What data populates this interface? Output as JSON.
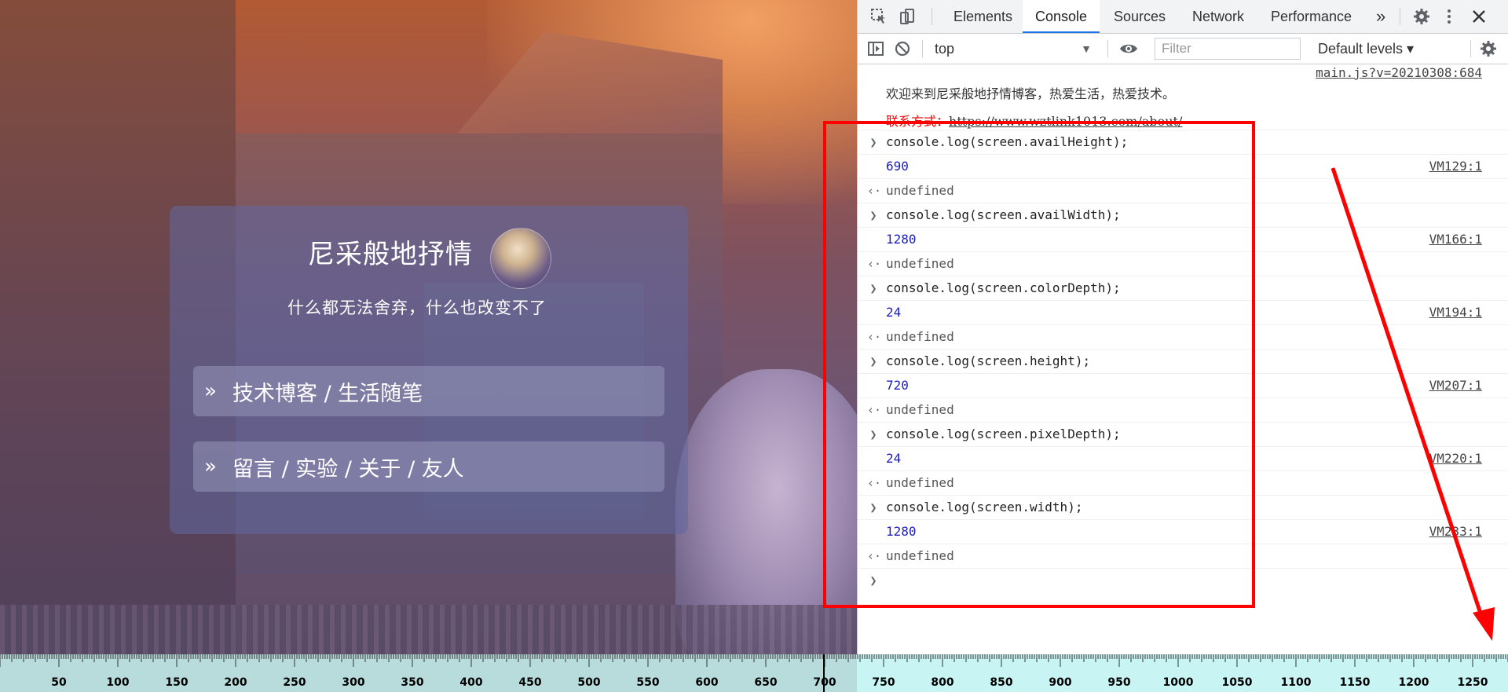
{
  "page": {
    "card": {
      "title": "尼采般地抒情",
      "subtitle": "什么都无法舍弃，什么也改变不了",
      "links": [
        {
          "chevron": "»",
          "label": "技术博客 / 生活随笔"
        },
        {
          "chevron": "»",
          "label": "留言 / 实验 / 关于 / 友人"
        }
      ]
    }
  },
  "devtools": {
    "tabs": [
      "Elements",
      "Console",
      "Sources",
      "Network",
      "Performance"
    ],
    "active_tab": "Console",
    "more_tabs": "»",
    "toolbar": {
      "context": "top",
      "filter_placeholder": "Filter",
      "levels": "Default levels ▾"
    },
    "console": {
      "welcome_source": "main.js?v=20210308:684",
      "welcome_text": "欢迎来到尼采般地抒情博客，热爱生活，热爱技术。",
      "contact_label": "联系方式：",
      "contact_url": "https://www.wztlink1013.com/about/",
      "entries": [
        {
          "command": "console.log(screen.availHeight);",
          "output": "690",
          "source": "VM129:1",
          "result": "undefined"
        },
        {
          "command": "console.log(screen.availWidth);",
          "output": "1280",
          "source": "VM166:1",
          "result": "undefined"
        },
        {
          "command": "console.log(screen.colorDepth);",
          "output": "24",
          "source": "VM194:1",
          "result": "undefined"
        },
        {
          "command": "console.log(screen.height);",
          "output": "720",
          "source": "VM207:1",
          "result": "undefined"
        },
        {
          "command": "console.log(screen.pixelDepth);",
          "output": "24",
          "source": "VM220:1",
          "result": "undefined"
        },
        {
          "command": "console.log(screen.width);",
          "output": "1280",
          "source": "VM233:1",
          "result": "undefined"
        }
      ]
    }
  },
  "ruler": {
    "labels": [
      "50",
      "100",
      "150",
      "200",
      "250",
      "300",
      "350",
      "400",
      "450",
      "500",
      "550",
      "600",
      "650",
      "700",
      "750",
      "800",
      "850",
      "900",
      "950",
      "1000",
      "1050",
      "1100",
      "1150",
      "1200",
      "1250"
    ]
  },
  "colors": {
    "annotation": "#ff0000",
    "active_tab": "#1a73e8",
    "number_output": "#1c1cc2"
  }
}
